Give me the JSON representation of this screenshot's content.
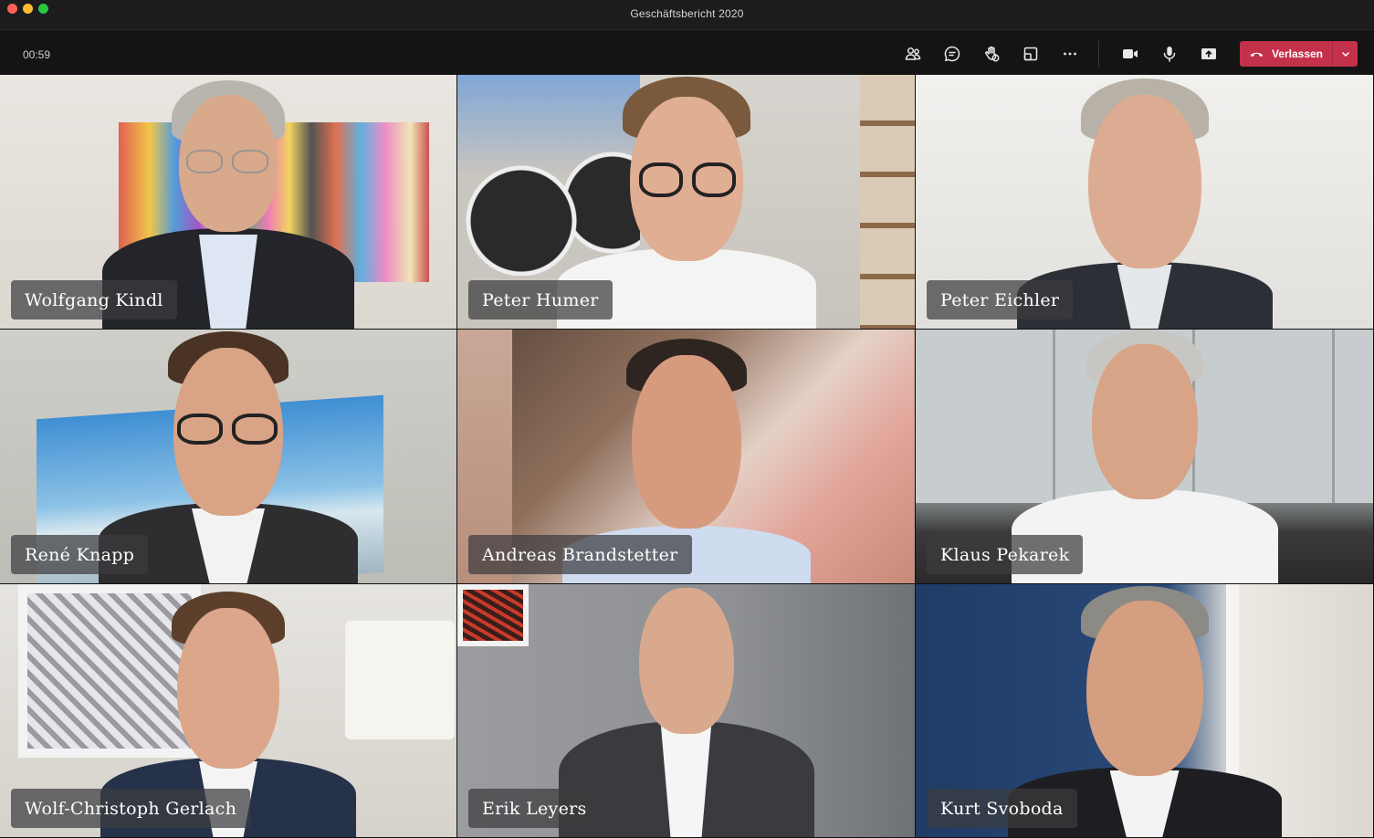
{
  "window": {
    "title": "Geschäftsbericht 2020"
  },
  "toolbar": {
    "timer": "00:59",
    "leave_label": "Verlassen",
    "buttons": [
      {
        "icon": "participants-icon"
      },
      {
        "icon": "chat-icon"
      },
      {
        "icon": "raise-hand-icon"
      },
      {
        "icon": "rooms-icon"
      },
      {
        "icon": "more-icon"
      },
      {
        "icon": "camera-icon"
      },
      {
        "icon": "microphone-icon"
      },
      {
        "icon": "share-screen-icon"
      }
    ],
    "leave_color": "#c4314b"
  },
  "participants": [
    {
      "name": "Wolfgang Kindl"
    },
    {
      "name": "Peter Humer"
    },
    {
      "name": "Peter Eichler"
    },
    {
      "name": "René Knapp"
    },
    {
      "name": "Andreas Brandstetter"
    },
    {
      "name": "Klaus Pekarek"
    },
    {
      "name": "Wolf-Christoph Gerlach"
    },
    {
      "name": "Erik Leyers"
    },
    {
      "name": "Kurt Svoboda"
    }
  ]
}
